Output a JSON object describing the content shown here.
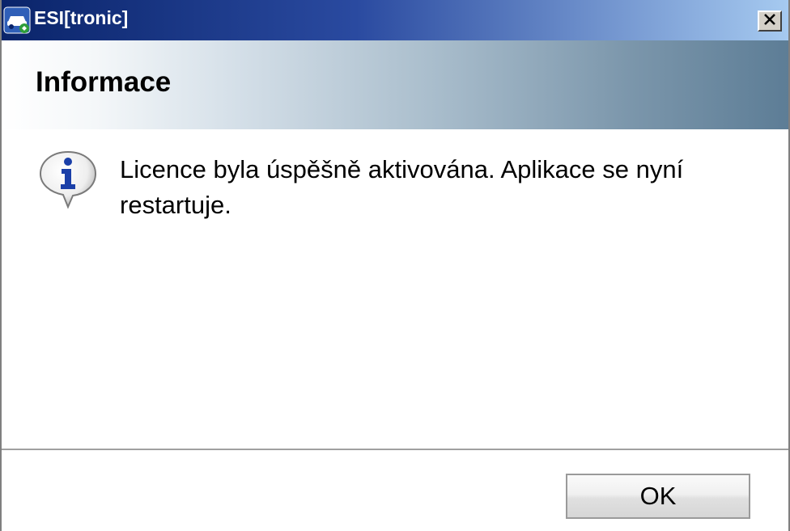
{
  "window": {
    "title": "ESI[tronic]",
    "close_icon": "close-icon",
    "app_icon": "car-icon"
  },
  "header": {
    "title": "Informace"
  },
  "message": {
    "icon": "info-icon",
    "text": "Licence byla úspěšně aktivována. Aplikace se nyní restartuje."
  },
  "buttons": {
    "ok_label": "OK"
  },
  "colors": {
    "titlebar_start": "#0a246a",
    "titlebar_end": "#a6caf0",
    "header_band_end": "#5d7d96",
    "info_blue": "#1a3fa8"
  }
}
